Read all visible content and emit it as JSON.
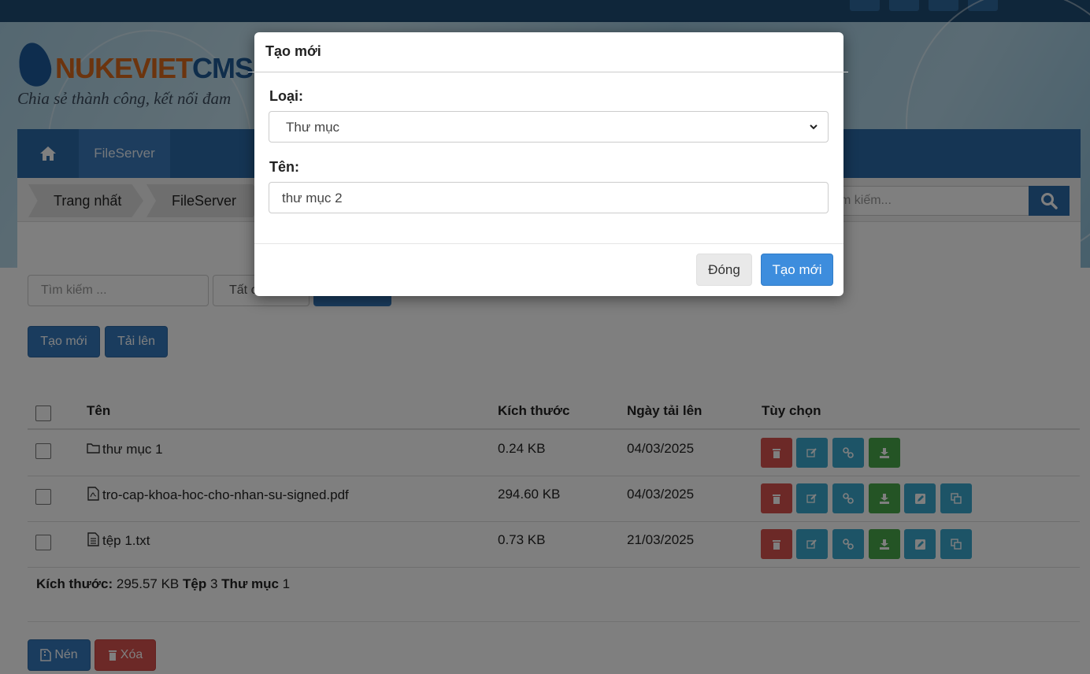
{
  "site": {
    "logo_main": "NUKEVIET",
    "logo_suffix": "CMS",
    "slogan": "Chia sẻ thành công, kết nối đam"
  },
  "nav": {
    "home_icon": "home-icon",
    "item": "FileServer"
  },
  "breadcrumb": [
    "Trang nhất",
    "FileServer"
  ],
  "top_search": {
    "placeholder": "m kiếm..."
  },
  "filters": {
    "search_placeholder": "Tìm kiếm ...",
    "select_value": "Tất c"
  },
  "toolbar": {
    "create_label": "Tạo mới",
    "upload_label": "Tải lên"
  },
  "table": {
    "headers": {
      "name": "Tên",
      "size": "Kích thước",
      "date": "Ngày tải lên",
      "options": "Tùy chọn"
    },
    "rows": [
      {
        "icon": "folder-icon",
        "name": "thư mục 1",
        "size": "0.24 KB",
        "date": "04/03/2025"
      },
      {
        "icon": "pdf-file-icon",
        "name": "tro-cap-khoa-hoc-cho-nhan-su-signed.pdf",
        "size": "294.60 KB",
        "date": "04/03/2025"
      },
      {
        "icon": "text-file-icon",
        "name": "tệp 1.txt",
        "size": "0.73 KB",
        "date": "21/03/2025"
      }
    ]
  },
  "summary": {
    "size_label": "Kích thước:",
    "size_value": "295.57 KB",
    "files_label": "Tệp",
    "files_value": "3",
    "folders_label": "Thư mục",
    "folders_value": "1"
  },
  "bulk": {
    "compress_label": "Nén",
    "delete_label": "Xóa"
  },
  "modal": {
    "title": "Tạo mới",
    "type_label": "Loại:",
    "type_value": "Thư mục",
    "name_label": "Tên:",
    "name_value": "thư mục 2",
    "close_label": "Đóng",
    "create_label": "Tạo mới"
  },
  "colors": {
    "primary": "#3579bd",
    "danger": "#d9534f",
    "info": "#3aa9cf",
    "success": "#48a84a",
    "nav": "#2b6aa8"
  }
}
